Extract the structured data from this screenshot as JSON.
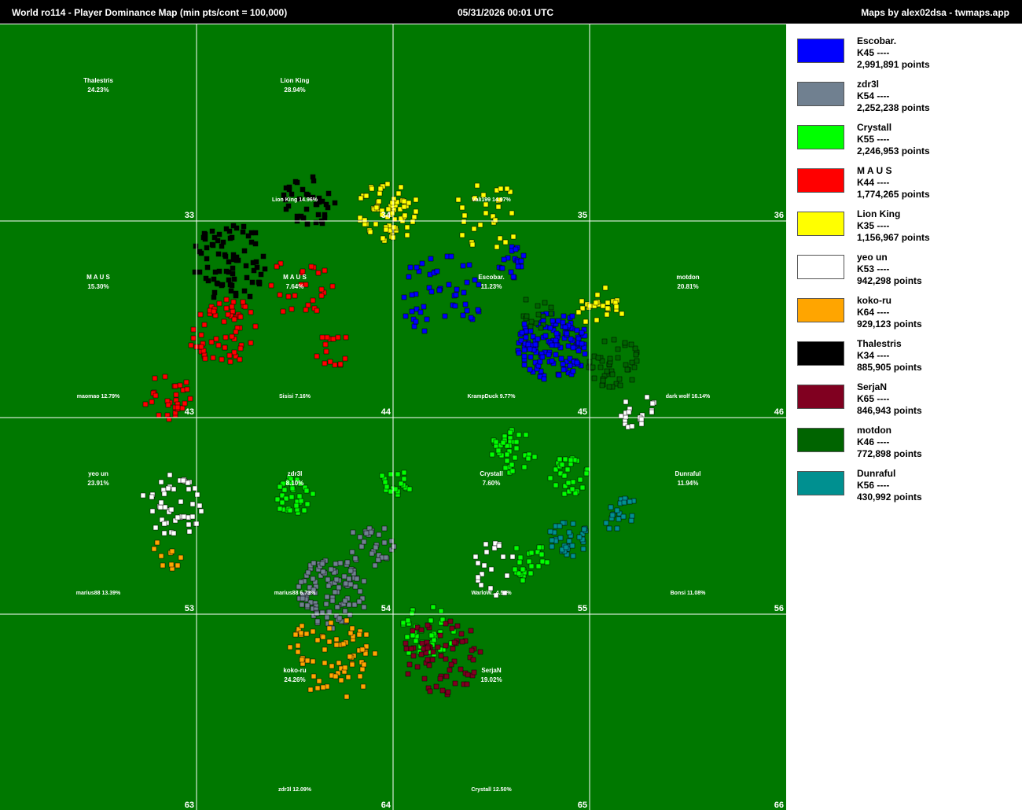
{
  "header": {
    "title": "World ro114  -  Player Dominance Map (min pts/cont = 100,000)",
    "date": "05/31/2026 00:01 UTC",
    "credit": "Maps by alex02dsa - twmaps.app"
  },
  "map": {
    "background": "#007800",
    "grid_color": "#ffffff",
    "continent_labels": [
      "33",
      "34",
      "35",
      "36",
      "43",
      "44",
      "45",
      "46",
      "53",
      "54",
      "55",
      "56",
      "63",
      "64",
      "65",
      "66"
    ],
    "dominance": [
      {
        "cell": "33",
        "name": "Thalestris",
        "pct": "24.23%"
      },
      {
        "cell": "34",
        "name": "Lion King",
        "pct": "28.94%"
      },
      {
        "cell": "43",
        "name": "M A U S",
        "pct": "15.30%"
      },
      {
        "cell": "44",
        "name": "M A U S",
        "pct": "7.64%"
      },
      {
        "cell": "45",
        "name": "Escobar.",
        "pct": "11.23%"
      },
      {
        "cell": "46",
        "name": "motdon",
        "pct": "20.81%"
      },
      {
        "cell": "53",
        "name": "yeo un",
        "pct": "23.91%"
      },
      {
        "cell": "54",
        "name": "zdr3l",
        "pct": "8.10%"
      },
      {
        "cell": "55",
        "name": "Crystall",
        "pct": "7.60%"
      },
      {
        "cell": "56",
        "name": "Dunraful",
        "pct": "11.94%"
      },
      {
        "cell": "64",
        "name": "koko-ru",
        "pct": "24.26%"
      },
      {
        "cell": "65",
        "name": "SerjaN",
        "pct": "19.02%"
      }
    ],
    "tribe_labels": [
      {
        "cell": "34",
        "text": "Lion King 14.96%"
      },
      {
        "cell": "35",
        "text": "Vali199 14.97%"
      },
      {
        "cell": "43",
        "text": "maomao 12.79%"
      },
      {
        "cell": "44",
        "text": "Sisisi 7.16%"
      },
      {
        "cell": "45",
        "text": "KrampDuck 9.77%"
      },
      {
        "cell": "46",
        "text": "dark wolf 16.14%"
      },
      {
        "cell": "53",
        "text": "marius88 13.39%"
      },
      {
        "cell": "54",
        "text": "marius88 6.73%"
      },
      {
        "cell": "55",
        "text": "WarloW.. 4.54%"
      },
      {
        "cell": "56",
        "text": "Bonsi 11.08%"
      },
      {
        "cell": "64",
        "text": "zdr3l 12.09%"
      },
      {
        "cell": "65",
        "text": "Crystall 12.50%"
      }
    ]
  },
  "legend": [
    {
      "name": "Escobar.",
      "cont": "K45 ----",
      "points": "2,991,891 points",
      "color": "#0000ff"
    },
    {
      "name": "zdr3l",
      "cont": "K54 ----",
      "points": "2,252,238 points",
      "color": "#708090"
    },
    {
      "name": "Crystall",
      "cont": "K55 ----",
      "points": "2,246,953 points",
      "color": "#00ff00"
    },
    {
      "name": "M A U S",
      "cont": "K44 ----",
      "points": "1,774,265 points",
      "color": "#ff0000"
    },
    {
      "name": "Lion King",
      "cont": "K35 ----",
      "points": "1,156,967 points",
      "color": "#ffff00"
    },
    {
      "name": "yeo un",
      "cont": "K53 ----",
      "points": "942,298 points",
      "color": "#ffffff"
    },
    {
      "name": "koko-ru",
      "cont": "K64 ----",
      "points": "929,123 points",
      "color": "#ffa500"
    },
    {
      "name": "Thalestris",
      "cont": "K34 ----",
      "points": "885,905 points",
      "color": "#000000"
    },
    {
      "name": "SerjaN",
      "cont": "K65 ----",
      "points": "846,943 points",
      "color": "#800020"
    },
    {
      "name": "motdon",
      "cont": "K46 ----",
      "points": "772,898 points",
      "color": "#006400"
    },
    {
      "name": "Dunraful",
      "cont": "K56 ----",
      "points": "430,992 points",
      "color": "#009090"
    }
  ]
}
